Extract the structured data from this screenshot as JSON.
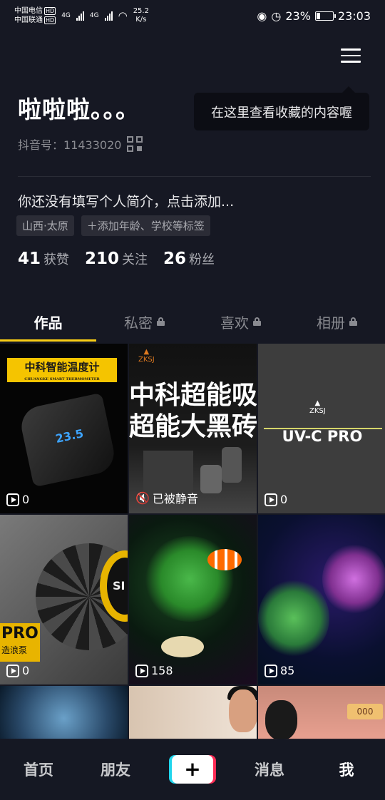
{
  "status_bar": {
    "carrier1": "中国电信",
    "carrier2": "中国联通",
    "hd": "HD",
    "network": "4G",
    "net_speed_value": "25.2",
    "net_speed_unit": "K/s",
    "battery_percent": "23%",
    "battery_level": 0.23,
    "time": "23:03",
    "icons": [
      "eye-icon",
      "alarm-icon",
      "wifi-icon",
      "battery-icon"
    ]
  },
  "header": {
    "menu_icon": "hamburger-menu-icon",
    "tooltip": "在这里查看收藏的内容喔"
  },
  "profile": {
    "username": "啦啦啦。。。",
    "douyin_id_label": "抖音号：",
    "douyin_id": "11433020",
    "bio": "你还没有填写个人简介，点击添加...",
    "tags": [
      "山西·太原",
      "＋添加年龄、学校等标签"
    ],
    "stats": [
      {
        "num": "41",
        "label": "获赞"
      },
      {
        "num": "210",
        "label": "关注"
      },
      {
        "num": "26",
        "label": "粉丝"
      }
    ]
  },
  "tabs": [
    {
      "label": "作品",
      "locked": false,
      "active": true
    },
    {
      "label": "私密",
      "locked": true,
      "active": false
    },
    {
      "label": "喜欢",
      "locked": true,
      "active": false
    },
    {
      "label": "相册",
      "locked": true,
      "active": false
    }
  ],
  "videos": [
    {
      "count": "0",
      "banner": "中科智能温度计",
      "banner_sub": "CHUANGKE SMART THERMOMETER",
      "display": "23.5"
    },
    {
      "status": "已被静音",
      "text_lines": [
        "中科超能吸",
        "超能大黑砖"
      ],
      "logo": "ZKSJ"
    },
    {
      "count": "0",
      "logo": "ZKSJ",
      "title": "UV-C PRO"
    },
    {
      "count": "0",
      "badge": "PRO",
      "badge_sub": "造浪泵",
      "ring_text": "SI"
    },
    {
      "count": "158"
    },
    {
      "count": "85"
    },
    {},
    {},
    {
      "sign": "000"
    }
  ],
  "bottom_nav": {
    "home": "首页",
    "friends": "朋友",
    "plus": "+",
    "messages": "消息",
    "me": "我"
  },
  "colors": {
    "background": "#161823",
    "accent_underline": "#face15",
    "plus_left": "#20d5ec",
    "plus_right": "#fe2c55"
  }
}
